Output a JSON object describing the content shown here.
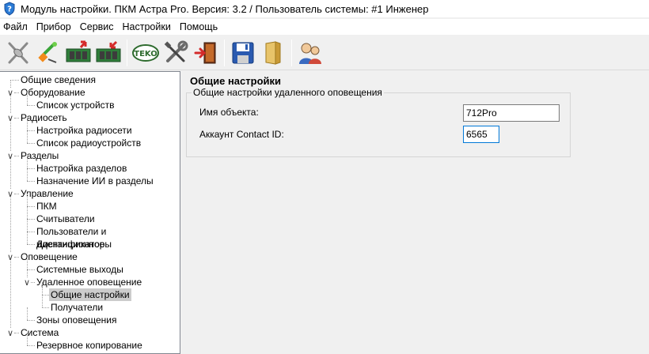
{
  "window": {
    "title": "Модуль настройки. ПКМ Астра Pro. Версия: 3.2 / Пользователь системы: #1 Инженер",
    "icon": "shield-question-icon"
  },
  "menu": [
    "Файл",
    "Прибор",
    "Сервис",
    "Настройки",
    "Помощь"
  ],
  "toolbar": {
    "groups": [
      [
        "disconnect-icon",
        "usb-connect-icon",
        "read-from-device-icon",
        "write-to-device-icon"
      ],
      [
        "teko-logo-icon",
        "tools-icon",
        "exit-icon"
      ],
      [
        "save-icon",
        "open-folder-icon"
      ],
      [
        "users-icon"
      ]
    ],
    "teko_text": "TEKO"
  },
  "tree": {
    "items": [
      {
        "label": "Общие сведения",
        "level": 0,
        "expander": "",
        "selected": false
      },
      {
        "label": "Оборудование",
        "level": 0,
        "expander": "expanded",
        "selected": false
      },
      {
        "label": "Список устройств",
        "level": 1,
        "expander": "",
        "selected": false
      },
      {
        "label": "Радиосеть",
        "level": 0,
        "expander": "expanded",
        "selected": false
      },
      {
        "label": "Настройка радиосети",
        "level": 1,
        "expander": "",
        "selected": false
      },
      {
        "label": "Список радиоустройств",
        "level": 1,
        "expander": "",
        "selected": false
      },
      {
        "label": "Разделы",
        "level": 0,
        "expander": "expanded",
        "selected": false
      },
      {
        "label": "Настройка разделов",
        "level": 1,
        "expander": "",
        "selected": false
      },
      {
        "label": "Назначение ИИ в разделы",
        "level": 1,
        "expander": "",
        "selected": false
      },
      {
        "label": "Управление",
        "level": 0,
        "expander": "expanded",
        "selected": false
      },
      {
        "label": "ПКМ",
        "level": 1,
        "expander": "",
        "selected": false
      },
      {
        "label": "Считыватели",
        "level": 1,
        "expander": "",
        "selected": false
      },
      {
        "label": "Пользователи и идентификаторы",
        "level": 1,
        "expander": "",
        "selected": false
      },
      {
        "label": "Дистанционное",
        "level": 1,
        "expander": "",
        "selected": false
      },
      {
        "label": "Оповещение",
        "level": 0,
        "expander": "expanded",
        "selected": false
      },
      {
        "label": "Системные выходы",
        "level": 1,
        "expander": "",
        "selected": false
      },
      {
        "label": "Удаленное оповещение",
        "level": 1,
        "expander": "expanded",
        "selected": false
      },
      {
        "label": "Общие настройки",
        "level": 2,
        "expander": "",
        "selected": true
      },
      {
        "label": "Получатели",
        "level": 2,
        "expander": "",
        "selected": false
      },
      {
        "label": "Зоны оповещения",
        "level": 1,
        "expander": "",
        "selected": false
      },
      {
        "label": "Система",
        "level": 0,
        "expander": "expanded",
        "selected": false
      },
      {
        "label": "Резервное копирование",
        "level": 1,
        "expander": "",
        "selected": false
      }
    ]
  },
  "content": {
    "title": "Общие настройки",
    "group_title": "Общие настройки удаленного оповещения",
    "fields": [
      {
        "label": "Имя объекта:",
        "value": "712Pro"
      },
      {
        "label": "Аккаунт Contact ID:",
        "value": "6565"
      }
    ]
  },
  "colors": {
    "selection": "#cccccc",
    "focus_border": "#0078d7",
    "window_bg": "#f0f0f0"
  }
}
